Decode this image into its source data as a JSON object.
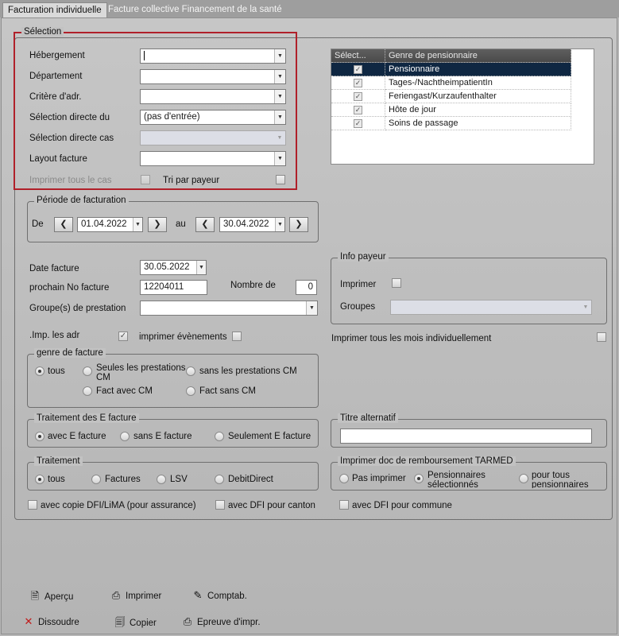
{
  "tabs": {
    "active": "Facturation individuelle",
    "inactive": "Facture collective Financement de la santé"
  },
  "selection": {
    "title": "Sélection",
    "hebergement_label": "Hébergement",
    "hebergement_value": "",
    "departement_label": "Département",
    "departement_value": "",
    "critere_label": "Critère d'adr.",
    "critere_value": "",
    "selection_directe_label": "Sélection directe du",
    "selection_directe_value": "(pas d'entrée)",
    "selection_cas_label": "Sélection directe cas",
    "selection_cas_value": "",
    "layout_label": "Layout facture",
    "layout_value": "",
    "imprimer_tous_cas_label": "Imprimer tous le cas",
    "tri_payeur_label": "Tri par payeur"
  },
  "grid": {
    "col_select": "Sélect...",
    "col_genre": "Genre de pensionnaire",
    "rows": [
      {
        "checked": "✓",
        "genre": "Pensionnaire"
      },
      {
        "checked": "✓",
        "genre": "Tages-/NachtheimpatientIn"
      },
      {
        "checked": "✓",
        "genre": "Feriengast/Kurzaufenthalter"
      },
      {
        "checked": "✓",
        "genre": "Hôte de jour"
      },
      {
        "checked": "✓",
        "genre": "Soins de passage"
      }
    ]
  },
  "periode": {
    "title": "Période de facturation",
    "de_label": "De",
    "de_value": "01.04.2022",
    "au_label": "au",
    "au_value": "30.04.2022",
    "prev_symbol": "❮",
    "next_symbol": "❯"
  },
  "facture": {
    "date_label": "Date facture",
    "date_value": "30.05.2022",
    "prochain_label": "prochain No facture",
    "prochain_value": "12204011",
    "nombre_label": "Nombre de",
    "nombre_value": "0",
    "groupes_label": "Groupe(s) de prestation",
    "groupes_value": "",
    "imp_adr_label": ".Imp. les adr",
    "imp_adr_checked": "✓",
    "imprimer_evenements_label": "imprimer évènements"
  },
  "info_payeur": {
    "title": "Info payeur",
    "imprimer_label": "Imprimer",
    "groupes_label": "Groupes",
    "groupes_value": ""
  },
  "imprimer_tous_mois_label": "Imprimer tous les mois individuellement",
  "genre_facture": {
    "title": "genre de facture",
    "opt_tous": "tous",
    "opt_seules": "Seules les prestations",
    "opt_seules_2": "CM",
    "opt_sans_prest": "sans les prestations CM",
    "opt_avec_cm": "Fact avec CM",
    "opt_sans_cm": "Fact sans CM"
  },
  "e_facture": {
    "title": "Traitement des E facture",
    "opt_avec": "avec E facture",
    "opt_sans": "sans E facture",
    "opt_seulement": "Seulement E facture"
  },
  "titre_alternatif": {
    "title": "Titre alternatif",
    "value": ""
  },
  "traitement": {
    "title": "Traitement",
    "opt_tous": "tous",
    "opt_factures": "Factures",
    "opt_lsv": "LSV",
    "opt_debit": "DebitDirect"
  },
  "tarmed": {
    "title": "Imprimer doc de remboursement TARMED",
    "opt_pas": "Pas imprimer",
    "opt_pens_1": "Pensionnaires",
    "opt_pens_2": "sélectionnés",
    "opt_tous_1": "pour tous",
    "opt_tous_2": "pensionnaires"
  },
  "dfi": {
    "assurance": "avec copie DFI/LiMA (pour assurance)",
    "canton": "avec DFI pour canton",
    "commune": "avec DFI pour commune"
  },
  "actions": {
    "apercu": "Aperçu",
    "imprimer": "Imprimer",
    "comptab": "Comptab.",
    "dissoudre": "Dissoudre",
    "copier": "Copier",
    "epreuve": "Epreuve d'impr."
  },
  "icons": {
    "apercu": "document-preview-icon",
    "imprimer": "printer-icon",
    "comptab": "accounting-icon",
    "dissoudre": "cross-icon",
    "copier": "copy-icon",
    "epreuve": "print-proof-icon"
  },
  "colors": {
    "highlight_border": "#b0202a",
    "selected_row": "#0f2742",
    "panel": "#c2c2c2"
  }
}
